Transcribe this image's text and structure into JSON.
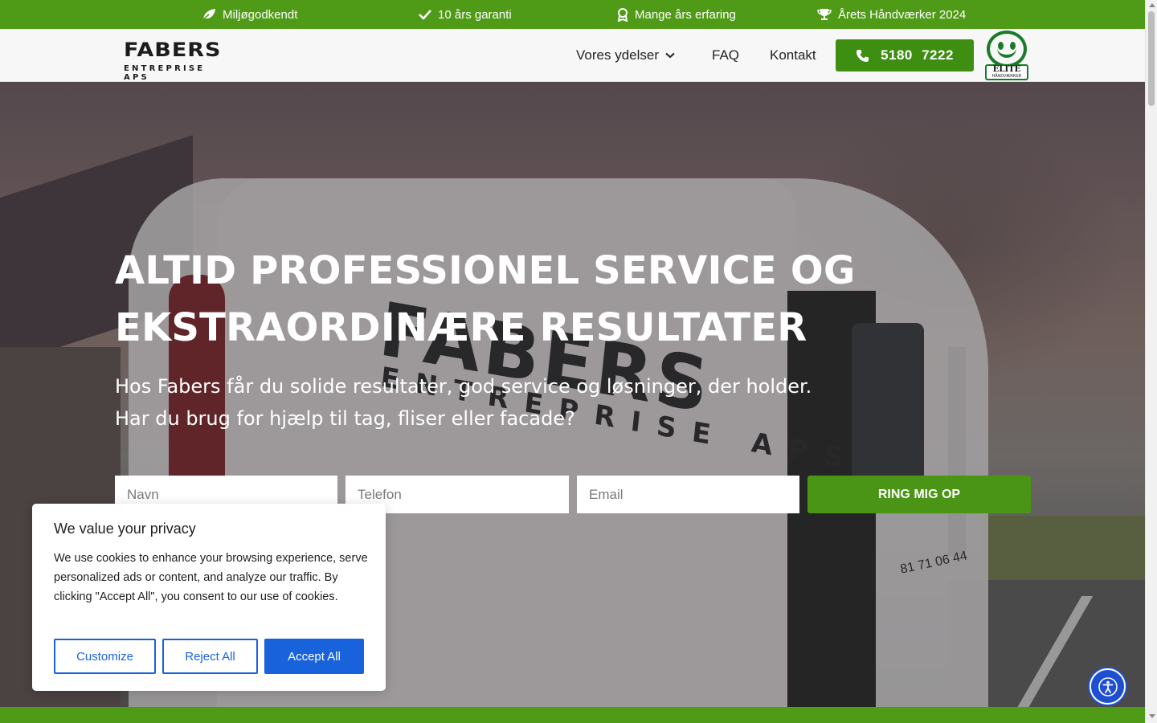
{
  "colors": {
    "brand_green": "#4f9a16",
    "button_green": "#3e8e12",
    "cookie_blue": "#1863dc",
    "accessibility_blue": "#1f4fd1"
  },
  "topbar": {
    "items": [
      {
        "icon": "leaf-icon",
        "label": "Miljøgodkendt"
      },
      {
        "icon": "check-icon",
        "label": "10 års garanti"
      },
      {
        "icon": "award-icon",
        "label": "Mange års erfaring"
      },
      {
        "icon": "trophy-icon",
        "label": "Årets Håndværker 2024"
      }
    ]
  },
  "header": {
    "logo": {
      "main": "FABERS",
      "sub": "ENTREPRISE APS"
    },
    "nav": {
      "services": "Vores ydelser",
      "faq": "FAQ",
      "contact": "Kontakt"
    },
    "call_button": {
      "icon": "phone-icon",
      "number": "5180 7222"
    },
    "badge": {
      "line1": "ELITE",
      "line2": "HÅNDVÆRKER"
    }
  },
  "hero": {
    "title_line1": "ALTID PROFESSIONEL SERVICE OG",
    "title_line2": "EKSTRAORDINÆRE RESULTATER",
    "subtitle_line1": "Hos Fabers får du solide resultater, god service og løsninger, der holder.",
    "subtitle_line2": "Har du brug for hjælp til tag, fliser eller facade?",
    "van_text_main": "FABERS",
    "van_text_sub": "ENTREPRISE APS",
    "van_phone": "81 71 06 44",
    "form": {
      "name_placeholder": "Navn",
      "phone_placeholder": "Telefon",
      "email_placeholder": "Email",
      "submit": "RING MIG OP"
    }
  },
  "cookie": {
    "title": "We value your privacy",
    "text": "We use cookies to enhance your browsing experience, serve personalized ads or content, and analyze our traffic. By clicking \"Accept All\", you consent to our use of cookies.",
    "customize": "Customize",
    "reject": "Reject All",
    "accept": "Accept All"
  },
  "accessibility": {
    "icon": "accessibility-icon"
  }
}
